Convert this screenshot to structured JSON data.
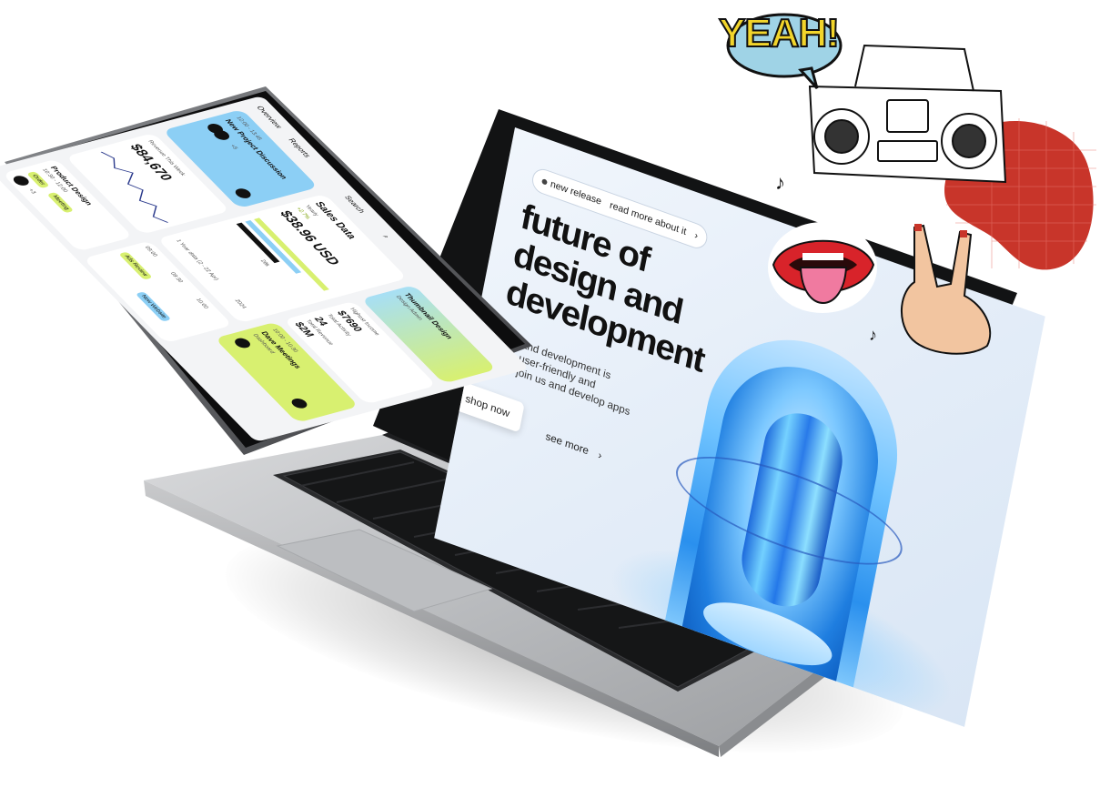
{
  "laptop_screen": {
    "pill_tag": "new release",
    "pill_link": "read more about it",
    "pill_arrow": "›",
    "headline_lines": [
      "future of",
      "design and",
      "development"
    ],
    "body_lines": [
      "and development is",
      "user-friendly and",
      "join us and develop apps"
    ],
    "shop_button": "shop now",
    "see_more": "see more",
    "see_more_arrow": "›"
  },
  "tablet_screen": {
    "nav": [
      "Overview",
      "Reports"
    ],
    "search_label": "Search",
    "product_card": {
      "title": "Product Design",
      "subtitle": "10:30 - 12:00",
      "chip_1": "Order",
      "chip_2": "Meeting",
      "badge": "+3"
    },
    "revenue_card": {
      "label": "Revenue This Week",
      "value": "$84,670"
    },
    "project_card": {
      "time": "12:00 - 13:45",
      "title": "New Project Discussion",
      "badge": "+5"
    },
    "sales_card": {
      "title": "Sales Data",
      "period": "Yearly",
      "change": "+2.7%",
      "value": "$38.96 USD",
      "footnote": "1 Year data (2 - 22 Apr)",
      "year": "2024",
      "mid_label": "28k"
    },
    "thumbnail_card": {
      "title": "Thumbnail Design",
      "subtitle": "Design Admin"
    },
    "stats": {
      "label_1": "Highest Income",
      "value_1": "$7690",
      "label_2": "Total Activity",
      "value_2": "24",
      "label_3": "Total Revenue",
      "value_3": "$2M"
    },
    "schedule": {
      "times": [
        "09:00",
        "09:30",
        "10:00"
      ],
      "event_1": "Ads Review",
      "event_2": "New Website",
      "event_3": "Dave Meetings",
      "event_3_time": "10:00 - 10:30",
      "event_3_sub": "Dashboard"
    }
  },
  "stickers": {
    "speech_bubble": "YEAH!"
  },
  "colors": {
    "accent_lime": "#d8f070",
    "accent_blue": "#8ccff5",
    "sticker_red": "#c8352a",
    "bubble_blue": "#9fd3e6",
    "yeah_yellow": "#f2d52b"
  }
}
